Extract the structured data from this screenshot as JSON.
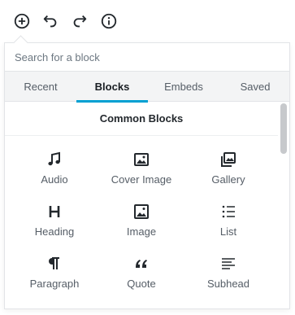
{
  "toolbar": {
    "add_icon": "plus-circle-icon",
    "undo_icon": "undo-icon",
    "redo_icon": "redo-icon",
    "info_icon": "info-icon"
  },
  "inserter": {
    "search_placeholder": "Search for a block",
    "tabs": [
      {
        "label": "Recent",
        "active": false
      },
      {
        "label": "Blocks",
        "active": true
      },
      {
        "label": "Embeds",
        "active": false
      },
      {
        "label": "Saved",
        "active": false
      }
    ],
    "section_title": "Common Blocks",
    "blocks": [
      {
        "label": "Audio",
        "icon": "music-note-icon"
      },
      {
        "label": "Cover Image",
        "icon": "cover-image-icon"
      },
      {
        "label": "Gallery",
        "icon": "gallery-icon"
      },
      {
        "label": "Heading",
        "icon": "heading-icon"
      },
      {
        "label": "Image",
        "icon": "image-icon"
      },
      {
        "label": "List",
        "icon": "list-icon"
      },
      {
        "label": "Paragraph",
        "icon": "paragraph-icon"
      },
      {
        "label": "Quote",
        "icon": "quote-icon"
      },
      {
        "label": "Subhead",
        "icon": "subhead-icon"
      }
    ]
  },
  "colors": {
    "accent": "#00a0d2",
    "text": "#23282d",
    "muted": "#555d66",
    "tab_bg": "#f3f4f5",
    "border": "#e2e4e7"
  }
}
